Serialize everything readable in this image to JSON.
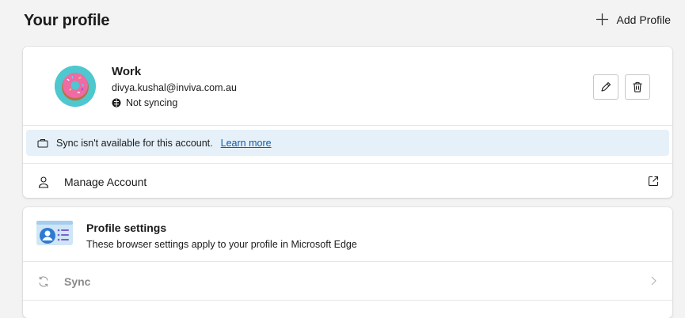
{
  "header": {
    "title": "Your profile",
    "add_profile_label": "Add Profile"
  },
  "profile": {
    "name": "Work",
    "email": "divya.kushal@inviva.com.au",
    "sync_status": "Not syncing",
    "avatar_color": "#4fc7cf"
  },
  "info_bar": {
    "message": "Sync isn't available for this account.",
    "link_label": "Learn more",
    "background": "#e5f0f9"
  },
  "manage_account": {
    "label": "Manage Account"
  },
  "profile_settings": {
    "title": "Profile settings",
    "description": "These browser settings apply to your profile in Microsoft Edge"
  },
  "settings_items": [
    {
      "label": "Sync"
    }
  ],
  "icons": {
    "add": "plus-icon",
    "edit": "pencil-icon",
    "delete": "trash-icon",
    "sync_status": "not-syncing-icon",
    "info": "briefcase-icon",
    "manage": "person-icon",
    "external": "open-external-icon",
    "settings": "profile-settings-illustration",
    "sync": "sync-icon",
    "chevron": "chevron-right-icon"
  }
}
